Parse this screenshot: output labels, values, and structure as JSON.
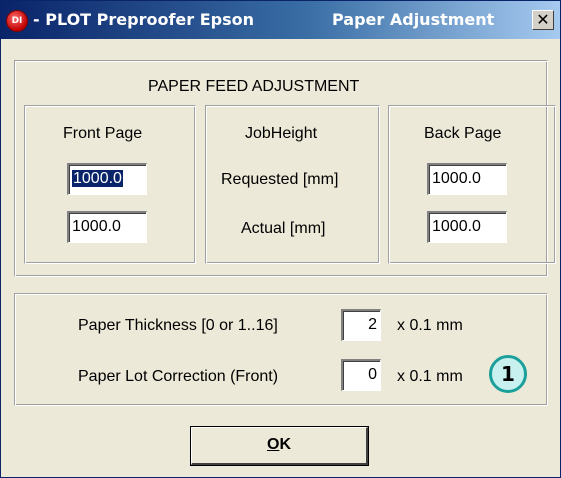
{
  "window": {
    "app_icon_text": "DI",
    "title_left": "- PLOT Preproofer Epson",
    "title_right": "Paper Adjustment",
    "close_label": "✕"
  },
  "feed": {
    "heading": "PAPER FEED ADJUSTMENT",
    "front": {
      "heading": "Front Page",
      "requested": "1000.0",
      "actual": "1000.0"
    },
    "job": {
      "heading": "JobHeight",
      "requested_label": "Requested [mm]",
      "actual_label": "Actual [mm]"
    },
    "back": {
      "heading": "Back Page",
      "requested": "1000.0",
      "actual": "1000.0"
    }
  },
  "thickness": {
    "label": "Paper Thickness [0 or 1..16]",
    "value": "2",
    "unit": "x 0.1 mm"
  },
  "lot": {
    "label": "Paper Lot Correction  (Front)",
    "value": "0",
    "unit": "x 0.1 mm"
  },
  "ok_button": {
    "mnemonic": "O",
    "rest": "K"
  },
  "callout": "1"
}
